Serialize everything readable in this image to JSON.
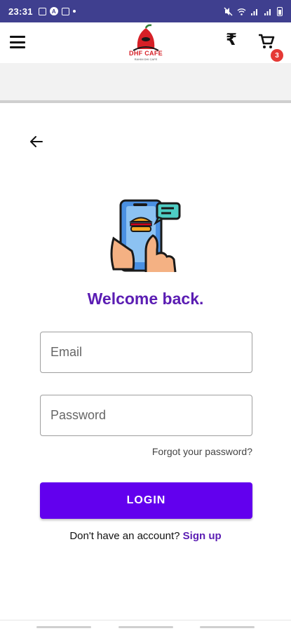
{
  "status_bar": {
    "time": "23:31",
    "icons": [
      "image-icon",
      "a-icon",
      "cast-icon",
      "dot-icon",
      "mute-icon",
      "wifi-icon",
      "signal-icon",
      "signal-icon",
      "battery-icon"
    ]
  },
  "header": {
    "logo_text": "DHF CAFE",
    "logo_subtext": "RAHIM DHI CAFE",
    "currency_symbol": "₹",
    "cart_count": "3"
  },
  "back_label": "←",
  "welcome_title": "Welcome back.",
  "form": {
    "email_placeholder": "Email",
    "email_value": "",
    "password_placeholder": "Password",
    "password_value": "",
    "forgot_password": "Forgot your password?",
    "login_label": "LOGIN",
    "no_account_text": "Don't have an account?",
    "signup_label": "Sign up"
  },
  "colors": {
    "status_bar": "#3f3f8f",
    "accent": "#6200ee",
    "title": "#5b1db3",
    "badge": "#e53935"
  }
}
